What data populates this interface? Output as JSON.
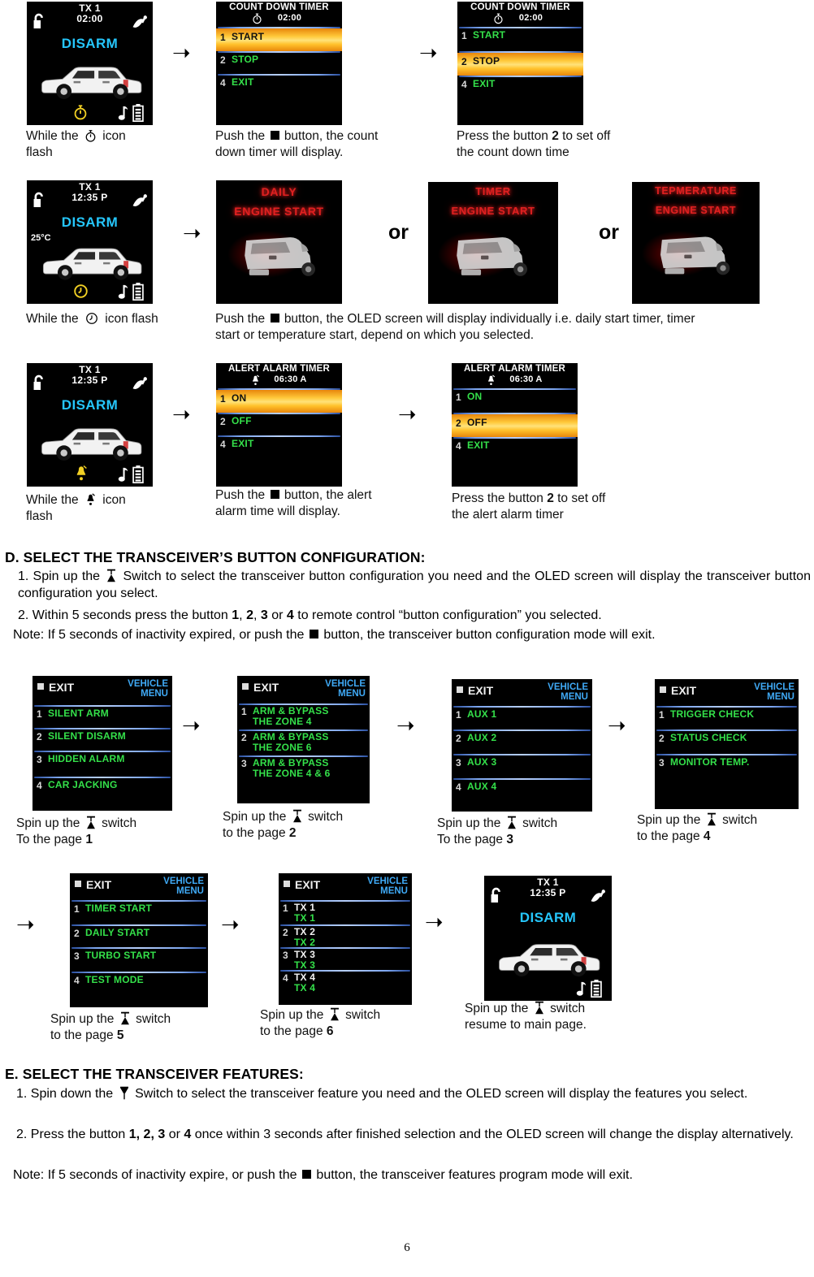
{
  "page": {
    "number": "6"
  },
  "row1": {
    "status_screen": {
      "tx": "TX 1",
      "time": "02:00",
      "mode": "DISARM",
      "icons": [
        "unlock-icon",
        "satellite-icon",
        "stopwatch-icon",
        "music-note-icon",
        "battery-icon"
      ]
    },
    "countdown_screen_a": {
      "title": "COUNT DOWN TIMER",
      "sub_time": "02:00",
      "items": [
        {
          "num": "1",
          "label": "START",
          "highlight": true
        },
        {
          "num": "2",
          "label": "STOP",
          "highlight": false
        },
        {
          "num": "4",
          "label": "EXIT",
          "highlight": false
        }
      ]
    },
    "countdown_screen_b": {
      "title": "COUNT DOWN TIMER",
      "sub_time": "02:00",
      "items": [
        {
          "num": "1",
          "label": "START",
          "highlight": false
        },
        {
          "num": "2",
          "label": "STOP",
          "highlight": true
        },
        {
          "num": "4",
          "label": "EXIT",
          "highlight": false
        }
      ]
    },
    "caption1_a": "While the",
    "caption1_b": "icon",
    "caption1_c": "flash",
    "caption2": "Push the",
    "caption2b": "button, the count",
    "caption2c": "down timer will display.",
    "caption3": "Press the button",
    "caption3_num": "2",
    "caption3b": "to set off",
    "caption3c": "the count down time"
  },
  "row2": {
    "status_screen": {
      "tx": "TX 1",
      "time": "12:35 P",
      "mode": "DISARM",
      "temp": "25°C",
      "icons": [
        "unlock-icon",
        "satellite-icon",
        "clock-icon",
        "music-note-icon",
        "battery-icon"
      ]
    },
    "engine_screens": [
      {
        "line1": "DAILY",
        "line2": "ENGINE START"
      },
      {
        "line1": "TIMER",
        "line2": "ENGINE START"
      },
      {
        "line1": "TEPMERATURE",
        "line2": "ENGINE START"
      }
    ],
    "or_label_1": "or",
    "or_label_2": "or",
    "caption1_a": "While the",
    "caption1_b": "icon flash",
    "caption2_a": "Push the",
    "caption2_b": "button, the OLED screen will display individually i.e. daily start timer, timer",
    "caption2_c": "start or temperature start, depend on which you selected."
  },
  "row3": {
    "status_screen": {
      "tx": "TX 1",
      "time": "12:35 P",
      "mode": "DISARM",
      "icons": [
        "unlock-icon",
        "satellite-icon",
        "bell-icon",
        "music-note-icon",
        "battery-icon"
      ]
    },
    "alert_screen_a": {
      "title": "ALERT ALARM TIMER",
      "sub_time": "06:30 A",
      "items": [
        {
          "num": "1",
          "label": "ON",
          "highlight": true
        },
        {
          "num": "2",
          "label": "OFF",
          "highlight": false
        },
        {
          "num": "4",
          "label": "EXIT",
          "highlight": false
        }
      ]
    },
    "alert_screen_b": {
      "title": "ALERT ALARM TIMER",
      "sub_time": "06:30 A",
      "items": [
        {
          "num": "1",
          "label": "ON",
          "highlight": false
        },
        {
          "num": "2",
          "label": "OFF",
          "highlight": true
        },
        {
          "num": "4",
          "label": "EXIT",
          "highlight": false
        }
      ]
    },
    "caption1_a": "While the",
    "caption1_b": "icon",
    "caption1_c": "flash",
    "caption2_a": "Push the",
    "caption2_b": "button, the alert",
    "caption2_c": "alarm time will display.",
    "caption3_a": "Press the button",
    "caption3_num": "2",
    "caption3_b": "to set off",
    "caption3_c": "the alert alarm timer"
  },
  "sectionD": {
    "heading": "D.   SELECT THE TRANSCEIVER’S BUTTON CONFIGURATION:",
    "item1_pre": "1. Spin up the",
    "item1_post": "Switch to select the transceiver button configuration you need and the OLED screen will display the transceiver button configuration you select.",
    "item2_pre": "2. Within 5 seconds press the button",
    "item2_n1": "1",
    "item2_n2": "2",
    "item2_n3": "3",
    "item2_n4": "4",
    "item2_mid": "or",
    "item2_post": "to remote control “button configuration” you selected.",
    "note_pre": "Note: If 5 seconds of inactivity expired, or push the",
    "note_post": "button, the transceiver button configuration mode will exit."
  },
  "vehicle_menu_pages": [
    {
      "exit": "EXIT",
      "title1": "VEHICLE",
      "title2": "MENU",
      "items": [
        {
          "num": "1",
          "label": "SILENT ARM"
        },
        {
          "num": "2",
          "label": "SILENT DISARM"
        },
        {
          "num": "3",
          "label": "HIDDEN ALARM"
        },
        {
          "num": "4",
          "label": "CAR JACKING"
        }
      ],
      "caption_a": "Spin up the",
      "caption_b": "switch",
      "caption_c": "To the page",
      "caption_page": "1"
    },
    {
      "exit": "EXIT",
      "title1": "VEHICLE",
      "title2": "MENU",
      "items": [
        {
          "num": "1",
          "label": "ARM & BYPASS",
          "label2": "THE ZONE 4"
        },
        {
          "num": "2",
          "label": "ARM & BYPASS",
          "label2": "THE ZONE 6"
        },
        {
          "num": "3",
          "label": "ARM & BYPASS",
          "label2": "THE ZONE 4 & 6"
        }
      ],
      "caption_a": "Spin up the",
      "caption_b": "switch",
      "caption_c": "to the page",
      "caption_page": "2"
    },
    {
      "exit": "EXIT",
      "title1": "VEHICLE",
      "title2": "MENU",
      "items": [
        {
          "num": "1",
          "label": "AUX  1"
        },
        {
          "num": "2",
          "label": "AUX  2"
        },
        {
          "num": "3",
          "label": "AUX  3"
        },
        {
          "num": "4",
          "label": "AUX  4"
        }
      ],
      "caption_a": "Spin up the",
      "caption_b": "switch",
      "caption_c": "To the page",
      "caption_page": "3"
    },
    {
      "exit": "EXIT",
      "title1": "VEHICLE",
      "title2": "MENU",
      "items": [
        {
          "num": "1",
          "label": "TRIGGER CHECK"
        },
        {
          "num": "2",
          "label": "STATUS  CHECK"
        },
        {
          "num": "3",
          "label": "MONITOR TEMP."
        }
      ],
      "caption_a": "Spin up the",
      "caption_b": "switch",
      "caption_c": "to the page",
      "caption_page": "4"
    },
    {
      "exit": "EXIT",
      "title1": "VEHICLE",
      "title2": "MENU",
      "items": [
        {
          "num": "1",
          "label": "TIMER START"
        },
        {
          "num": "2",
          "label": "DAILY START"
        },
        {
          "num": "3",
          "label": "TURBO START"
        },
        {
          "num": "4",
          "label": "TEST MODE"
        }
      ],
      "caption_a": "Spin up the",
      "caption_b": "switch",
      "caption_c": "to the page",
      "caption_page": "5"
    },
    {
      "exit": "EXIT",
      "title1": "VEHICLE",
      "title2": "MENU",
      "items": [
        {
          "num": "1",
          "label": "TX 1",
          "label2": "TX 1"
        },
        {
          "num": "2",
          "label": "TX 2",
          "label2": "TX 2"
        },
        {
          "num": "3",
          "label": "TX 3",
          "label2": "TX 3"
        },
        {
          "num": "4",
          "label": "TX 4",
          "label2": "TX 4"
        }
      ],
      "caption_a": "Spin up the",
      "caption_b": "switch",
      "caption_c": "to the page",
      "caption_page": "6"
    }
  ],
  "final_step": {
    "status_screen": {
      "tx": "TX 1",
      "time": "12:35 P",
      "mode": "DISARM",
      "icons": [
        "unlock-icon",
        "satellite-icon",
        "music-note-icon",
        "battery-icon"
      ]
    },
    "caption_a": "Spin up the",
    "caption_b": "switch",
    "caption_c": "resume to main page."
  },
  "sectionE": {
    "heading": "E.   SELECT THE TRANSCEIVER FEATURES:",
    "item1_pre": "1. Spin down the",
    "item1_post": "Switch to select the transceiver feature you need and the OLED screen will display the features you select.",
    "item2_pre": "2. Press the button",
    "item2_nums": "1, 2, 3",
    "item2_mid": "or",
    "item2_n4": "4",
    "item2_post": "once within 3 seconds after finished selection and the OLED screen will change the display alternatively.",
    "note_pre": "Note: If 5 seconds of inactivity expire, or push the",
    "note_post": "button, the transceiver features program mode will exit."
  },
  "colors": {
    "disarm_blue": "#25c6fb",
    "menu_green": "#34e04a",
    "menu_title_blue": "#3fa9f5",
    "highlight_orange": "#ffc12b",
    "engine_red": "#e02020",
    "divider_blue": "#7da6ef"
  }
}
